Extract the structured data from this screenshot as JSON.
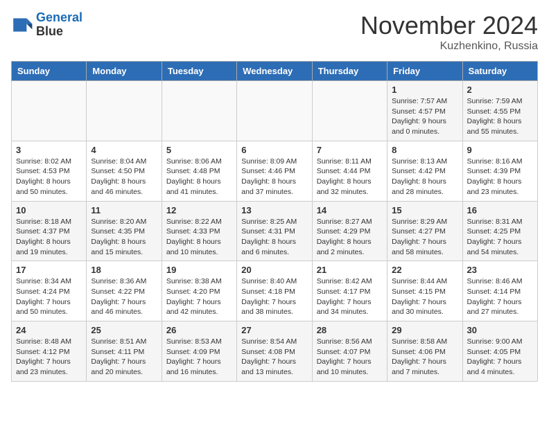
{
  "header": {
    "logo_line1": "General",
    "logo_line2": "Blue",
    "month": "November 2024",
    "location": "Kuzhenkino, Russia"
  },
  "weekdays": [
    "Sunday",
    "Monday",
    "Tuesday",
    "Wednesday",
    "Thursday",
    "Friday",
    "Saturday"
  ],
  "weeks": [
    [
      {
        "day": "",
        "info": ""
      },
      {
        "day": "",
        "info": ""
      },
      {
        "day": "",
        "info": ""
      },
      {
        "day": "",
        "info": ""
      },
      {
        "day": "",
        "info": ""
      },
      {
        "day": "1",
        "info": "Sunrise: 7:57 AM\nSunset: 4:57 PM\nDaylight: 9 hours\nand 0 minutes."
      },
      {
        "day": "2",
        "info": "Sunrise: 7:59 AM\nSunset: 4:55 PM\nDaylight: 8 hours\nand 55 minutes."
      }
    ],
    [
      {
        "day": "3",
        "info": "Sunrise: 8:02 AM\nSunset: 4:53 PM\nDaylight: 8 hours\nand 50 minutes."
      },
      {
        "day": "4",
        "info": "Sunrise: 8:04 AM\nSunset: 4:50 PM\nDaylight: 8 hours\nand 46 minutes."
      },
      {
        "day": "5",
        "info": "Sunrise: 8:06 AM\nSunset: 4:48 PM\nDaylight: 8 hours\nand 41 minutes."
      },
      {
        "day": "6",
        "info": "Sunrise: 8:09 AM\nSunset: 4:46 PM\nDaylight: 8 hours\nand 37 minutes."
      },
      {
        "day": "7",
        "info": "Sunrise: 8:11 AM\nSunset: 4:44 PM\nDaylight: 8 hours\nand 32 minutes."
      },
      {
        "day": "8",
        "info": "Sunrise: 8:13 AM\nSunset: 4:42 PM\nDaylight: 8 hours\nand 28 minutes."
      },
      {
        "day": "9",
        "info": "Sunrise: 8:16 AM\nSunset: 4:39 PM\nDaylight: 8 hours\nand 23 minutes."
      }
    ],
    [
      {
        "day": "10",
        "info": "Sunrise: 8:18 AM\nSunset: 4:37 PM\nDaylight: 8 hours\nand 19 minutes."
      },
      {
        "day": "11",
        "info": "Sunrise: 8:20 AM\nSunset: 4:35 PM\nDaylight: 8 hours\nand 15 minutes."
      },
      {
        "day": "12",
        "info": "Sunrise: 8:22 AM\nSunset: 4:33 PM\nDaylight: 8 hours\nand 10 minutes."
      },
      {
        "day": "13",
        "info": "Sunrise: 8:25 AM\nSunset: 4:31 PM\nDaylight: 8 hours\nand 6 minutes."
      },
      {
        "day": "14",
        "info": "Sunrise: 8:27 AM\nSunset: 4:29 PM\nDaylight: 8 hours\nand 2 minutes."
      },
      {
        "day": "15",
        "info": "Sunrise: 8:29 AM\nSunset: 4:27 PM\nDaylight: 7 hours\nand 58 minutes."
      },
      {
        "day": "16",
        "info": "Sunrise: 8:31 AM\nSunset: 4:25 PM\nDaylight: 7 hours\nand 54 minutes."
      }
    ],
    [
      {
        "day": "17",
        "info": "Sunrise: 8:34 AM\nSunset: 4:24 PM\nDaylight: 7 hours\nand 50 minutes."
      },
      {
        "day": "18",
        "info": "Sunrise: 8:36 AM\nSunset: 4:22 PM\nDaylight: 7 hours\nand 46 minutes."
      },
      {
        "day": "19",
        "info": "Sunrise: 8:38 AM\nSunset: 4:20 PM\nDaylight: 7 hours\nand 42 minutes."
      },
      {
        "day": "20",
        "info": "Sunrise: 8:40 AM\nSunset: 4:18 PM\nDaylight: 7 hours\nand 38 minutes."
      },
      {
        "day": "21",
        "info": "Sunrise: 8:42 AM\nSunset: 4:17 PM\nDaylight: 7 hours\nand 34 minutes."
      },
      {
        "day": "22",
        "info": "Sunrise: 8:44 AM\nSunset: 4:15 PM\nDaylight: 7 hours\nand 30 minutes."
      },
      {
        "day": "23",
        "info": "Sunrise: 8:46 AM\nSunset: 4:14 PM\nDaylight: 7 hours\nand 27 minutes."
      }
    ],
    [
      {
        "day": "24",
        "info": "Sunrise: 8:48 AM\nSunset: 4:12 PM\nDaylight: 7 hours\nand 23 minutes."
      },
      {
        "day": "25",
        "info": "Sunrise: 8:51 AM\nSunset: 4:11 PM\nDaylight: 7 hours\nand 20 minutes."
      },
      {
        "day": "26",
        "info": "Sunrise: 8:53 AM\nSunset: 4:09 PM\nDaylight: 7 hours\nand 16 minutes."
      },
      {
        "day": "27",
        "info": "Sunrise: 8:54 AM\nSunset: 4:08 PM\nDaylight: 7 hours\nand 13 minutes."
      },
      {
        "day": "28",
        "info": "Sunrise: 8:56 AM\nSunset: 4:07 PM\nDaylight: 7 hours\nand 10 minutes."
      },
      {
        "day": "29",
        "info": "Sunrise: 8:58 AM\nSunset: 4:06 PM\nDaylight: 7 hours\nand 7 minutes."
      },
      {
        "day": "30",
        "info": "Sunrise: 9:00 AM\nSunset: 4:05 PM\nDaylight: 7 hours\nand 4 minutes."
      }
    ]
  ]
}
